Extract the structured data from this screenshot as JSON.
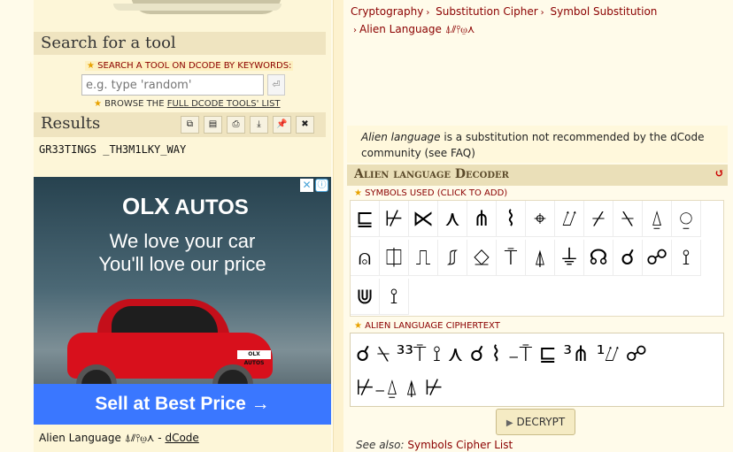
{
  "left": {
    "search_head": "Search for a tool",
    "search_caption": "SEARCH A TOOL ON DCODE BY KEYWORDS:",
    "search_placeholder": "e.g. type 'random'",
    "browse_prefix": "BROWSE THE",
    "browse_link": "FULL DCODE TOOLS' LIST",
    "results_head": "Results",
    "result_text": "GR33TINGS _TH3M1LKY_WAY",
    "result_tools": [
      "⧉",
      "▤",
      "⎙",
      "⤓",
      "📌",
      "✖"
    ],
    "ad": {
      "brand_mark": "OLX",
      "brand_word": "AUTOS",
      "line1": "We love your car",
      "line2": "You'll love our price",
      "plate": "OLX AUTOS",
      "cta": "Sell at Best Price →",
      "info": "ⓘ",
      "close": "✕"
    },
    "footer_prefix": "Alien Language ⍋⫽⫯⍹⋏ -",
    "footer_link": "dCode"
  },
  "breadcrumb": {
    "items": [
      "Cryptography",
      "Substitution Cipher",
      "Symbol Substitution",
      "Alien Language ⍋⫽⫯⍹⋏"
    ]
  },
  "intro": {
    "italic": "Alien language",
    "rest": " is a substitution not recommended by the dCode community (see FAQ)"
  },
  "tool": {
    "title": "Alien language Decoder",
    "symbols_label": "SYMBOLS USED (CLICK TO ADD)",
    "cipher_label": "ALIEN LANGUAGE CIPHERTEXT",
    "decrypt_label": "DECRYPT",
    "symbols": [
      "⊑",
      "⊬",
      "⋉",
      "⋏",
      "⋔",
      "⌇",
      "⌖",
      "⌰",
      "⌿",
      "⍀",
      "⍙",
      "⍜",
      "⍝",
      "⎅",
      "⎍",
      "⎎",
      "⎐",
      "⍑",
      "⍋",
      "⏚",
      "☊",
      "☌",
      "☍",
      "⟟",
      "⋓",
      "⟟"
    ],
    "ciphertext_line1": "☌ ⍀ ³³⍑ ⟟ ⋏ ☌ ⌇ ₋⍑ ⊑ ³⋔ ¹⌰ ☍",
    "ciphertext_line2": "⊬₋⍙ ⍋ ⊬"
  },
  "see_also": {
    "prefix": "See also:",
    "link": "Symbols Cipher List"
  }
}
